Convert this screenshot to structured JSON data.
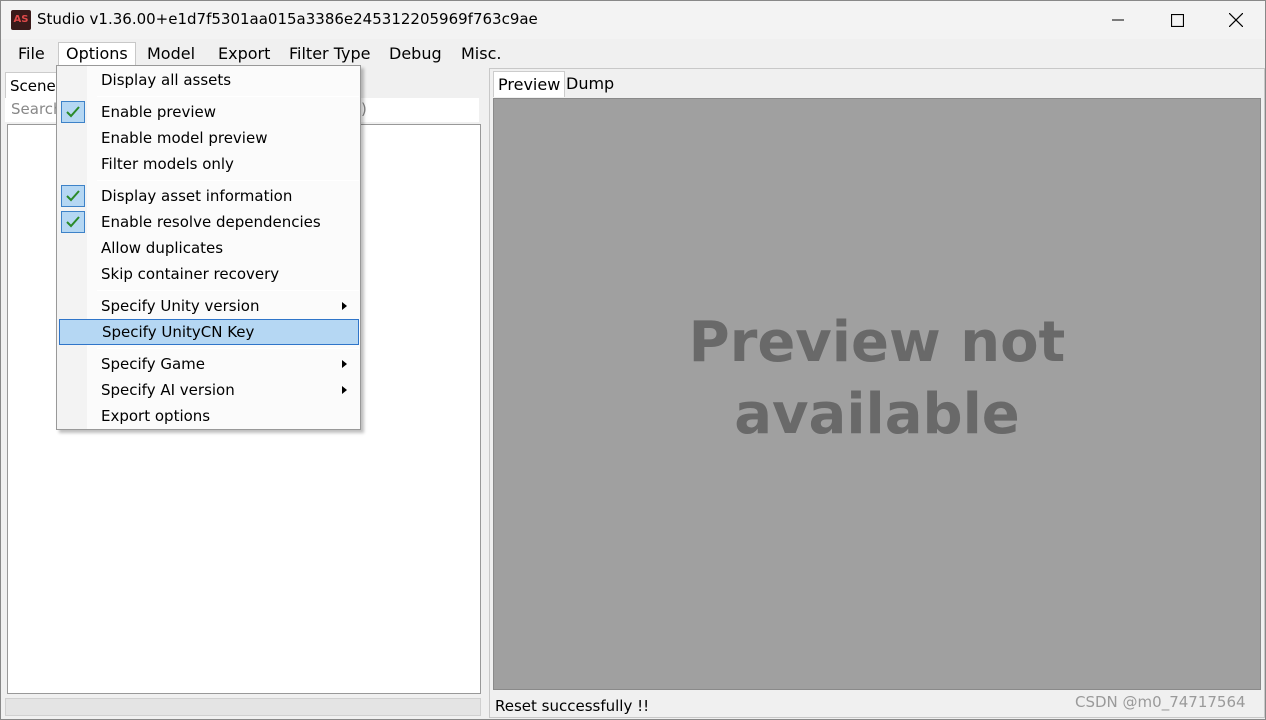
{
  "window": {
    "title": "Studio v1.36.00+e1d7f5301aa015a3386e245312205969f763c9ae",
    "icon_text": "AS"
  },
  "menubar": {
    "items": [
      "File",
      "Options",
      "Model",
      "Export",
      "Filter Type",
      "Debug",
      "Misc."
    ],
    "open_menu": "Options"
  },
  "left_panel": {
    "tab_label": "Scene",
    "search_placeholder": "Search",
    "search_tail": ")"
  },
  "right_panel": {
    "tabs": [
      "Preview",
      "Dump"
    ],
    "active_tab": "Preview",
    "preview_message": "Preview not available",
    "status_text": "Reset successfully !!"
  },
  "options_menu": {
    "items": [
      {
        "label": "Display all assets",
        "checked": false,
        "submenu": false
      },
      {
        "label": "Enable preview",
        "checked": true,
        "submenu": false
      },
      {
        "label": "Enable model preview",
        "checked": false,
        "submenu": false
      },
      {
        "label": "Filter models only",
        "checked": false,
        "submenu": false
      },
      {
        "label": "Display asset information",
        "checked": true,
        "submenu": false
      },
      {
        "label": "Enable resolve dependencies",
        "checked": true,
        "submenu": false
      },
      {
        "label": "Allow duplicates",
        "checked": false,
        "submenu": false
      },
      {
        "label": "Skip container recovery",
        "checked": false,
        "submenu": false
      },
      {
        "label": "Specify Unity version",
        "checked": false,
        "submenu": true
      },
      {
        "label": "Specify UnityCN Key",
        "checked": false,
        "submenu": false,
        "highlighted": true
      },
      {
        "label": "Specify Game",
        "checked": false,
        "submenu": true
      },
      {
        "label": "Specify AI version",
        "checked": false,
        "submenu": true
      },
      {
        "label": "Export options",
        "checked": false,
        "submenu": false
      }
    ]
  },
  "watermark": "CSDN @m0_74717564",
  "colors": {
    "highlight": "#b5d7f3",
    "highlight_border": "#2f75c9",
    "preview_bg": "#a0a0a0",
    "preview_text": "#696969",
    "check_mark": "#2a8a2a"
  },
  "icons": {
    "minimize": "minimize-icon",
    "maximize": "maximize-icon",
    "close": "close-icon",
    "check": "check-icon",
    "submenu": "submenu-arrow-icon"
  }
}
